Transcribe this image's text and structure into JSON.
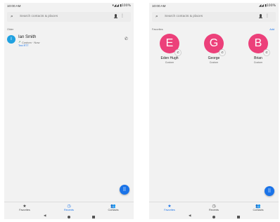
{
  "left_screen": {
    "status": {
      "time": "10:00 AM",
      "icons": "▾◢◢ ▮100%"
    },
    "search": {
      "placeholder": "Search contacts & places"
    },
    "section_label": "Older",
    "call": {
      "avatar_letter": "I",
      "name": "Ian Smith",
      "direction_icon": "↗",
      "detail": "Custom · Now",
      "rtt": "Text RTT"
    },
    "nav": {
      "favorites": "Favorites",
      "recents": "Recents",
      "contacts": "Contacts",
      "active": "recents"
    }
  },
  "right_screen": {
    "status": {
      "time": "10:00 AM",
      "icons": "◢◢ ▮100%"
    },
    "search": {
      "placeholder": "Search contacts & places"
    },
    "section_label": "Favorites",
    "add_label": "Add",
    "favorites": [
      {
        "letter": "E",
        "name": "Eden Hugh",
        "type": "Custom"
      },
      {
        "letter": "G",
        "name": "George",
        "type": "Custom"
      },
      {
        "letter": "B",
        "name": "Brian",
        "type": "Custom"
      }
    ],
    "nav": {
      "favorites": "Favorites",
      "recents": "Recents",
      "contacts": "Contacts",
      "active": "favorites"
    }
  },
  "colors": {
    "accent": "#1a73e8",
    "avatar_blue": "#1fa1e0",
    "avatar_pink": "#ec407a"
  },
  "icons": {
    "search": "⌕",
    "more": "⋮",
    "phone": "✆",
    "dialpad": "⠿",
    "star": "★",
    "clock": "◷",
    "people": "👥",
    "back": "◀"
  }
}
